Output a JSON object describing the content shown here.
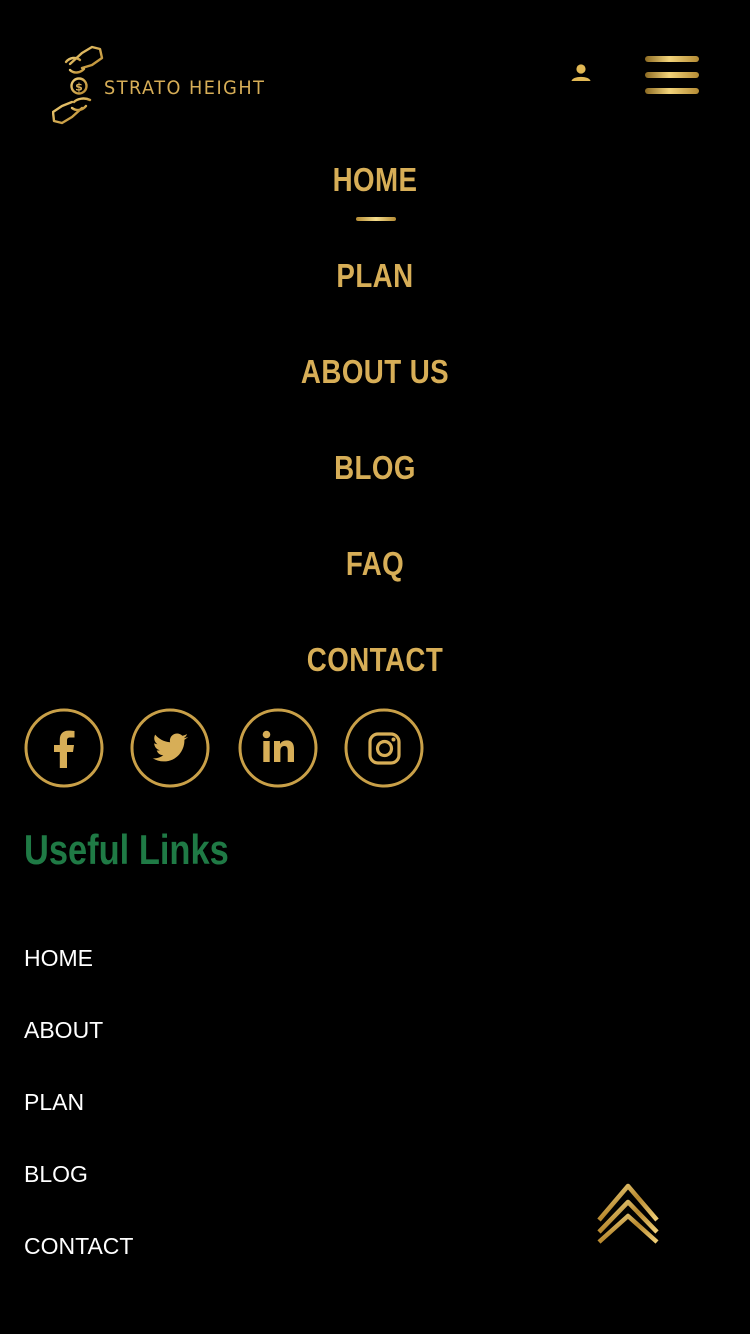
{
  "header": {
    "brand": "STRATO HEIGHT",
    "logo_icon": "hands-coin-icon",
    "user_icon": "user-icon",
    "menu_icon": "hamburger-menu-icon"
  },
  "nav": {
    "items": [
      {
        "label": "HOME",
        "active": true
      },
      {
        "label": "PLAN"
      },
      {
        "label": "ABOUT US"
      },
      {
        "label": "BLOG"
      },
      {
        "label": "FAQ"
      },
      {
        "label": "CONTACT"
      }
    ]
  },
  "social": {
    "icons": [
      "facebook-icon",
      "twitter-icon",
      "linkedin-icon",
      "instagram-icon"
    ]
  },
  "footer": {
    "title": "Useful Links",
    "links": [
      "HOME",
      "ABOUT",
      "PLAN",
      "BLOG",
      "CONTACT"
    ]
  },
  "scroll_top_icon": "double-chevron-up-icon",
  "colors": {
    "background": "#000000",
    "gold": "#d7ae57",
    "green": "#1f7a45",
    "white": "#ffffff"
  }
}
